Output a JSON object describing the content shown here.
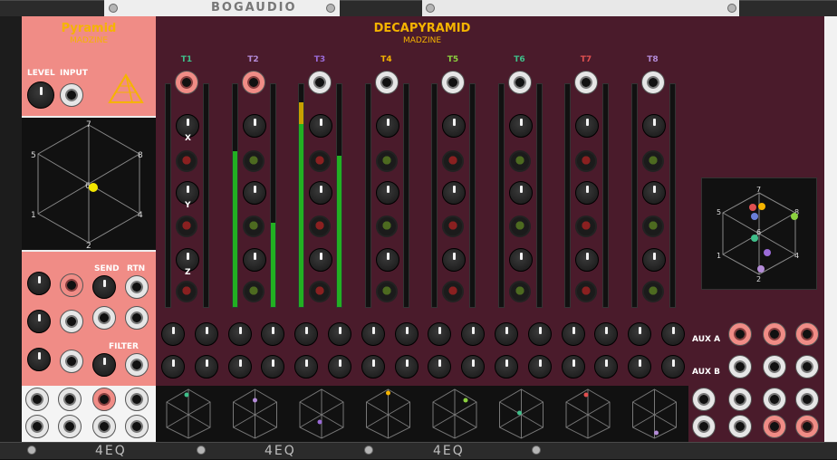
{
  "rack": {
    "brand_top": "BOGAUDIO",
    "brand_bottom": "4EQ"
  },
  "pyramid": {
    "title": "Pyramid",
    "maker": "MADZINE",
    "labels": {
      "level": "LEVEL",
      "input": "INPUT",
      "send": "SEND",
      "rtn": "RTN",
      "filter": "FILTER",
      "x": "X",
      "y": "Y",
      "z": "Z"
    },
    "speaker_labels": [
      "7",
      "5",
      "8",
      "6",
      "1",
      "4",
      "2"
    ]
  },
  "decapyramid": {
    "title": "DECAPYRAMID",
    "maker": "MADZINE",
    "tracks": [
      "T1",
      "T2",
      "T3",
      "T4",
      "T5",
      "T6",
      "T7",
      "T8"
    ],
    "track_colors": [
      "#3fbf8a",
      "#b48cd8",
      "#9b6bd8",
      "#f5b400",
      "#8bd13f",
      "#3fbf8a",
      "#e05050",
      "#b48cd8"
    ],
    "axis_labels": {
      "x": "X",
      "y": "Y",
      "z": "Z"
    },
    "aux_a": "AUX A",
    "aux_b": "AUX B",
    "meter_levels": [
      0,
      0.7,
      0.92,
      0,
      0,
      0,
      0,
      0
    ],
    "meter_levels_right": [
      0,
      0.38,
      0.68,
      0,
      0,
      0,
      0,
      0
    ]
  }
}
